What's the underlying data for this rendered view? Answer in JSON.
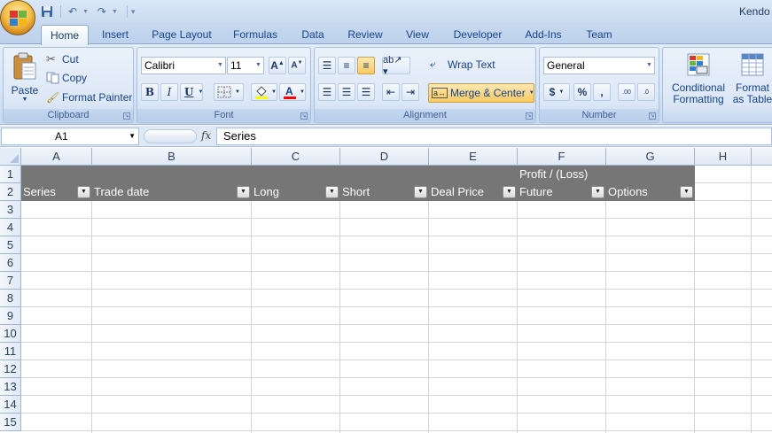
{
  "window": {
    "title": "Kendo"
  },
  "tabs": [
    "Home",
    "Insert",
    "Page Layout",
    "Formulas",
    "Data",
    "Review",
    "View",
    "Developer",
    "Add-Ins",
    "Team"
  ],
  "clipboard": {
    "paste": "Paste",
    "cut": "Cut",
    "copy": "Copy",
    "format_painter": "Format Painter",
    "label": "Clipboard"
  },
  "font": {
    "family": "Calibri",
    "size": "11",
    "bold": "B",
    "italic": "I",
    "underline": "U",
    "label": "Font"
  },
  "alignment": {
    "wrap_text": "Wrap Text",
    "merge_center": "Merge & Center",
    "label": "Alignment"
  },
  "number": {
    "format": "General",
    "currency": "$",
    "percent": "%",
    "comma": ",",
    "increase_decimal": ".00",
    "decrease_decimal": ".0",
    "label": "Number"
  },
  "styles": {
    "conditional_formatting_1": "Conditional",
    "conditional_formatting_2": "Formatting",
    "format_as_table_1": "Format",
    "format_as_table_2": "as Table"
  },
  "formula_bar": {
    "name_box": "A1",
    "fx": "fx",
    "value": "Series"
  },
  "columns": [
    "A",
    "B",
    "C",
    "D",
    "E",
    "F",
    "G",
    "H"
  ],
  "rows": [
    "1",
    "2",
    "3",
    "4",
    "5",
    "6",
    "7",
    "8",
    "9",
    "10",
    "11",
    "12",
    "13",
    "14",
    "15"
  ],
  "table_header": {
    "group_title": "Profit / (Loss)",
    "series": "Series",
    "trade_date": "Trade date",
    "long": "Long",
    "short": "Short",
    "deal_price": "Deal Price",
    "future": "Future",
    "options": "Options"
  },
  "colors": {
    "header_band": "#767676",
    "merge_highlight": "#f9c862",
    "fill_yellow": "#ffff00",
    "font_red": "#ff0000"
  }
}
